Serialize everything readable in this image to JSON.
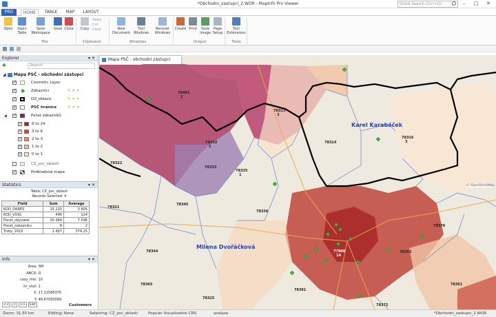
{
  "window": {
    "title": "*Obchodni_zastupci_2.WOR - MapInfo Pro Viewer",
    "search_placeholder": "Quick Search (Ctrl+Q)"
  },
  "tabs": [
    {
      "label": "PRO"
    },
    {
      "label": "HOME"
    },
    {
      "label": "TABLE"
    },
    {
      "label": "MAP"
    },
    {
      "label": "LAYOUT"
    }
  ],
  "ribbon": {
    "buttons": [
      {
        "label": "Open"
      },
      {
        "label": "Open Table"
      },
      {
        "label": "Save Workspace"
      },
      {
        "label": "Save"
      },
      {
        "label": "Close"
      },
      {
        "label": "Copy"
      },
      {
        "label": "Paste"
      },
      {
        "label": "Cut"
      },
      {
        "label": "Clear"
      },
      {
        "label": "New Document"
      },
      {
        "label": "Tool Windows"
      },
      {
        "label": "Recover Windows"
      },
      {
        "label": "Create"
      },
      {
        "label": "Print"
      },
      {
        "label": "Save Image"
      },
      {
        "label": "Page Setup"
      },
      {
        "label": "Tool Extensions"
      }
    ],
    "groups": [
      "File",
      "Clipboard",
      "Windows",
      "Output",
      "Tools"
    ]
  },
  "explorer": {
    "title": "Explorer",
    "search_placeholder": "Search",
    "map_name": "Mapa PSČ - obchodní zástupci",
    "layers": [
      {
        "label": "Cosmetic Layer",
        "checked": true
      },
      {
        "label": "Zákazníci",
        "checked": true
      },
      {
        "label": "OZ_oblasti",
        "checked": true
      },
      {
        "label": "PSČ hranice",
        "checked": true
      },
      {
        "label": "Počet zákazníků",
        "checked": true
      }
    ],
    "legend": [
      {
        "label": "6 to 24",
        "color": "#a81d1d"
      },
      {
        "label": "3 to 6",
        "color": "#d1473c"
      },
      {
        "label": "2 to 3",
        "color": "#e78a6c"
      },
      {
        "label": "1 to 2",
        "color": "#f3be98"
      },
      {
        "label": "0 to 1",
        "color": "#fbe6cf"
      }
    ],
    "extra_layers": [
      {
        "label": "CZ_psc_oblasti",
        "checked": false
      },
      {
        "label": "Podkladová mapa",
        "checked": true
      }
    ]
  },
  "statistics": {
    "title": "Statistics",
    "table_line": "Table: CZ_psc_oblasti",
    "selected_line": "Records Selected: 4",
    "headers": [
      "Field",
      "Sum",
      "Average"
    ],
    "rows": [
      [
        "KOD_OKRES",
        "15 220",
        "3 805"
      ],
      [
        "KOD_VUSC",
        "496",
        "124"
      ],
      [
        "Pocet_obyvatel",
        "30 384",
        "7 596"
      ],
      [
        "Pocet_zakazniku",
        "8",
        "2"
      ],
      [
        "Trzby_2019",
        "1 497",
        "374,25"
      ]
    ]
  },
  "info": {
    "title": "Info",
    "fields": [
      {
        "k": "Area:",
        "v": "SM"
      },
      {
        "k": "ABCD:",
        "v": "D"
      },
      {
        "k": "casy_min:",
        "v": "10"
      },
      {
        "k": "hr_visit:",
        "v": "1"
      },
      {
        "k": "X:",
        "v": "17,22586376"
      },
      {
        "k": "Y:",
        "v": "48,67050099"
      }
    ],
    "nav": [
      "<<",
      "<",
      ">>",
      "List"
    ],
    "table_name": "Customers"
  },
  "map": {
    "tab_title": "Mapa PSČ - obchodní zástupci",
    "rep_names": [
      "Karel Karabáček",
      "Milena Dvořáčková"
    ],
    "zip_labels": [
      "78401",
      "78313",
      "78314",
      "78316",
      "78332",
      "78322",
      "78333",
      "78335",
      "78345",
      "78336",
      "78344",
      "78353",
      "78301",
      "78372",
      "77900",
      "78361",
      "78365",
      "78321",
      "78325",
      "78376"
    ],
    "small_labels": [
      "1",
      "2",
      "3",
      "14"
    ],
    "attribution": "© OpenStreetMap"
  },
  "status": {
    "zoom": "Zoom: 31,55 km",
    "editing": "Editing: None",
    "selecting": "Selecting: CZ_psc_oblasti",
    "crs": "Popular Visualization CRS",
    "analyse": "analyse",
    "doc": "*Obchodni_zastupci_2.WOR"
  }
}
